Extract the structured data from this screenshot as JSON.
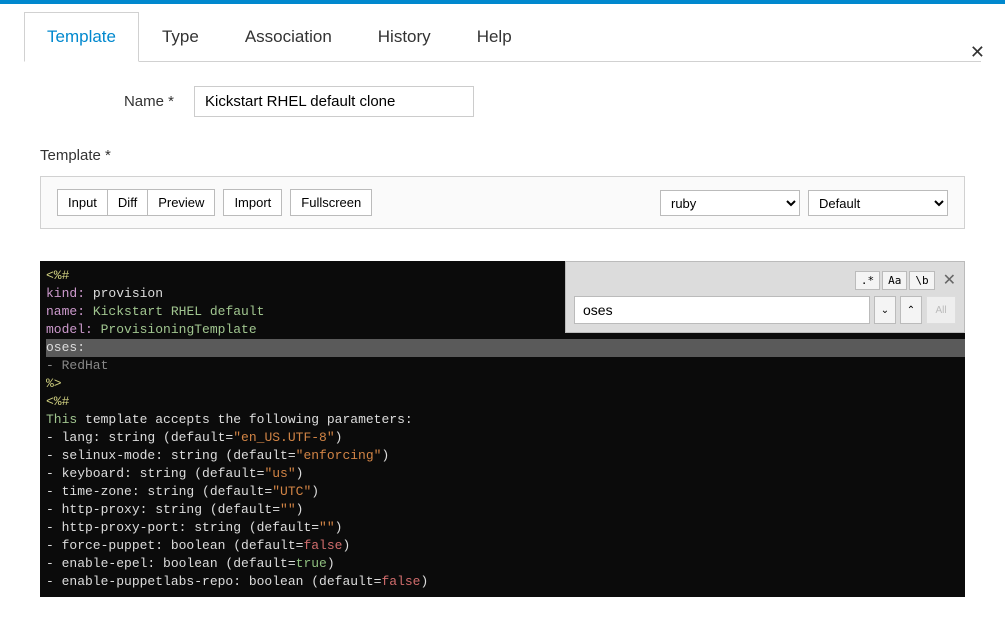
{
  "tabs": [
    "Template",
    "Type",
    "Association",
    "History",
    "Help"
  ],
  "active_tab": 0,
  "name_label": "Name *",
  "name_value": "Kickstart RHEL default clone",
  "template_label": "Template *",
  "toolbar": {
    "input": "Input",
    "diff": "Diff",
    "preview": "Preview",
    "import": "Import",
    "fullscreen": "Fullscreen"
  },
  "syntax_select": "ruby",
  "keybinding_select": "Default",
  "search": {
    "regex": ".*",
    "case": "Aa",
    "whole": "\\b",
    "value": "oses",
    "all": "All"
  },
  "close_label": "✕",
  "code": {
    "l1_open": "<%#",
    "l2_k": "kind:",
    "l2_v": "provision",
    "l3_k": "name:",
    "l3_v": "Kickstart RHEL default",
    "l4_k": "model:",
    "l4_v": "ProvisioningTemplate",
    "l5": "oses:",
    "l6": "- RedHat",
    "l7": "%>",
    "l8": "<%#",
    "l9a": "This",
    "l9b": " template accepts the following parameters:",
    "l10a": "- lang: string (default=",
    "l10b": "\"en_US.UTF-8\"",
    "l10c": ")",
    "l11a": "- selinux-mode: string (default=",
    "l11b": "\"enforcing\"",
    "l11c": ")",
    "l12a": "- keyboard: string (default=",
    "l12b": "\"us\"",
    "l12c": ")",
    "l13a": "- time-zone: string (default=",
    "l13b": "\"UTC\"",
    "l13c": ")",
    "l14a": "- http-proxy: string (default=",
    "l14b": "\"\"",
    "l14c": ")",
    "l15a": "- http-proxy-port: string (default=",
    "l15b": "\"\"",
    "l15c": ")",
    "l16a": "- force-puppet: boolean (default=",
    "l16b": "false",
    "l16c": ")",
    "l17a": "- enable-epel: boolean (default=",
    "l17b": "true",
    "l17c": ")",
    "l18a": "- enable-puppetlabs-repo: boolean (default=",
    "l18b": "false",
    "l18c": ")"
  }
}
